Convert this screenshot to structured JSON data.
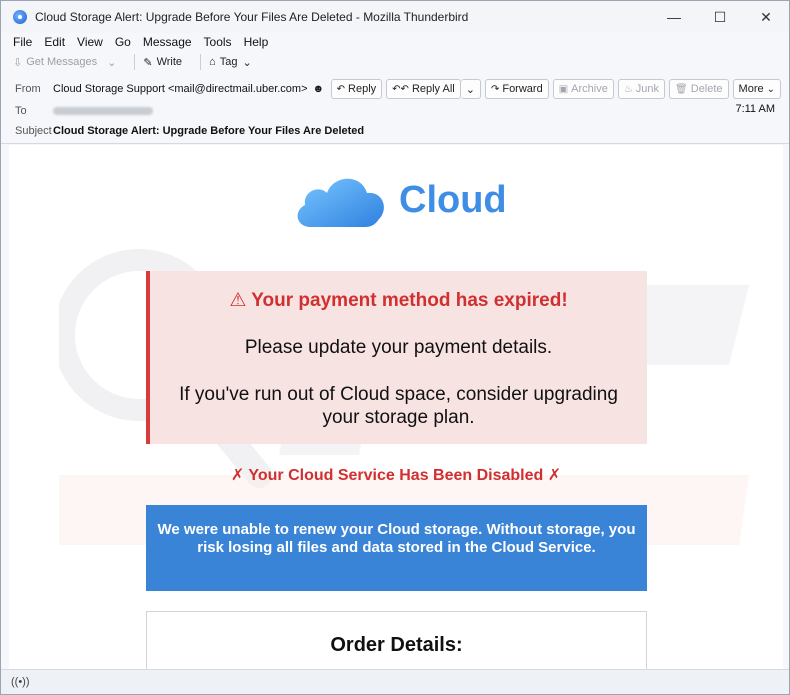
{
  "window": {
    "title": "Cloud Storage Alert: Upgrade Before Your Files Are Deleted - Mozilla Thunderbird",
    "controls": [
      "—",
      "☐",
      "✕"
    ]
  },
  "menu": [
    "File",
    "Edit",
    "View",
    "Go",
    "Message",
    "Tools",
    "Help"
  ],
  "toolbar": {
    "get_messages": "Get Messages",
    "write": "Write",
    "tag": "Tag"
  },
  "header": {
    "from_label": "From",
    "from_value": "Cloud Storage Support <mail@directmail.uber.com>",
    "to_label": "To",
    "subject_label": "Subject",
    "subject_value": "Cloud Storage Alert: Upgrade Before Your Files Are Deleted",
    "time": "7:11 AM",
    "buttons": {
      "reply": "Reply",
      "reply_all": "Reply All",
      "forward": "Forward",
      "archive": "Archive",
      "junk": "Junk",
      "delete": "Delete",
      "more": "More"
    }
  },
  "email": {
    "logo_text": "Cloud",
    "alert_title": "⚠ Your payment method has expired!",
    "alert_line1": "Please update your payment details.",
    "alert_line2": "If you've run out of Cloud space, consider upgrading your storage plan.",
    "disabled_notice": "✗ Your Cloud Service Has Been Disabled ✗",
    "blue_box": "We were unable to renew your Cloud storage. Without storage, you risk losing all files and data stored in the Cloud Service.",
    "order_title": "Order Details:"
  },
  "colors": {
    "alert_red": "#d03030",
    "alert_bg": "#f8e3e3",
    "blue_box": "#3a84d8",
    "logo_blue": "#3f8ee6"
  }
}
